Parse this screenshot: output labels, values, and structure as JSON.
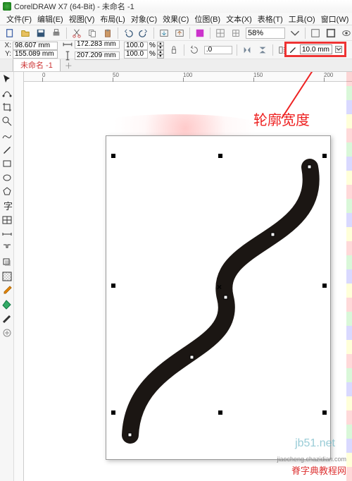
{
  "title": "CorelDRAW X7 (64-Bit) - 未命名 -1",
  "menu": [
    "文件(F)",
    "编辑(E)",
    "视图(V)",
    "布局(L)",
    "对象(C)",
    "效果(C)",
    "位图(B)",
    "文本(X)",
    "表格(T)",
    "工具(O)",
    "窗口(W)"
  ],
  "toolbar": {
    "zoom": "58%"
  },
  "prop": {
    "x_label": "X:",
    "x": "98.607 mm",
    "y_label": "Y:",
    "y": "155.089 mm",
    "w": "172.283 mm",
    "h": "207.209 mm",
    "sx": "100.0",
    "sy": "100.0",
    "rotate": ".0",
    "outline": "10.0 mm"
  },
  "tab": "未命名 -1",
  "ruler_ticks": [
    "0",
    "50",
    "100",
    "150",
    "200"
  ],
  "annotation": "轮廓宽度",
  "watermarks": {
    "a": "jb51.net",
    "b": "脊字典教程网",
    "c": "jiaocheng.chazidian.com"
  }
}
